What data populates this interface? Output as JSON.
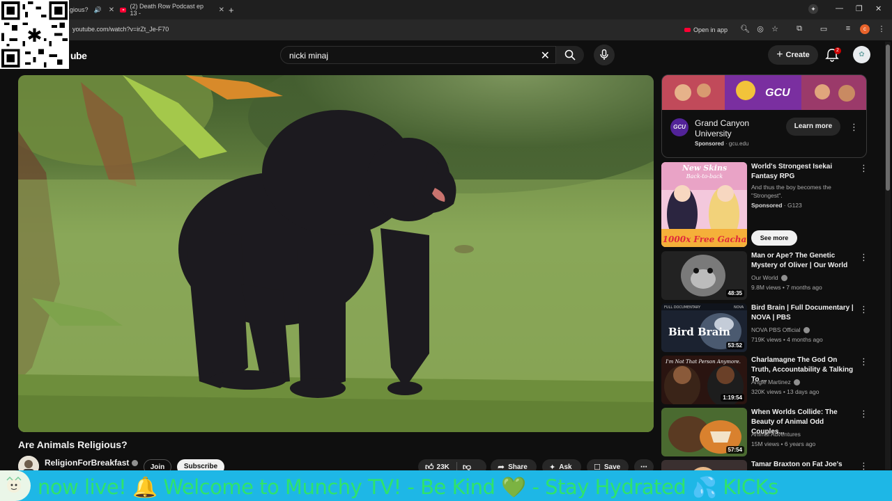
{
  "browser": {
    "tabs": [
      {
        "label": "gious?",
        "active": true
      },
      {
        "label": "(2) Death Row Podcast ep 13 -",
        "active": false
      }
    ],
    "url": "youtube.com/watch?v=irZt_Je-F70",
    "open_in_app_label": "Open in app",
    "profile_initial": "c"
  },
  "header": {
    "logo_fragment": "ube",
    "search_query": "nicki minaj",
    "create_label": "Create",
    "notification_count": "2"
  },
  "video": {
    "title": "Are Animals Religious?",
    "channel": "ReligionForBreakfast",
    "join_label": "Join",
    "subscribe_label": "Subscribe",
    "likes": "23K",
    "share_label": "Share",
    "ask_label": "Ask",
    "save_label": "Save"
  },
  "ad": {
    "banner_text": "GCU",
    "logo_text": "GCU",
    "title": "Grand Canyon University",
    "sponsored": "Sponsored",
    "domain": "· gcu.edu",
    "cta": "Learn more"
  },
  "recommendations": [
    {
      "title": "World's Strongest Isekai Fantasy RPG",
      "line1": "And thus the boy becomes the \"Strongest\".",
      "line2_bold": "Sponsored",
      "line2": "· G123",
      "duration": "",
      "cta": "See more",
      "thumb_text_top": "New Skins",
      "thumb_text_mid": "Back-to-back",
      "thumb_text_bottom": "1000x Free Gacha"
    },
    {
      "title": "Man or Ape? The Genetic Mystery of Oliver | Our World",
      "line1": "Our World",
      "line2": "9.8M views • 7 months ago",
      "duration": "48:35"
    },
    {
      "title": "Bird Brain | Full Documentary | NOVA | PBS",
      "line1": "NOVA PBS Official",
      "line2": "719K views • 4 months ago",
      "duration": "53:52",
      "thumb_text": "Bird Brain",
      "thumb_tag_left": "FULL DOCUMENTARY",
      "thumb_tag_right": "NOVA"
    },
    {
      "title": "Charlamagne The God On Truth, Accountability & Talking To ...",
      "line1": "Angie Martinez",
      "line2": "320K views • 13 days ago",
      "duration": "1:19:54",
      "thumb_text": "I'm Not That Person Anymore."
    },
    {
      "title": "When Worlds Collide: The Beauty of Animal Odd Couples...",
      "line1": "Animal Adventures",
      "line2": "15M views • 6 years ago",
      "duration": "57:54"
    },
    {
      "title": "Tamar Braxton on Fat Joe's",
      "line1": "",
      "line2": "",
      "duration": ""
    }
  ],
  "ticker": {
    "text": "now live!  🔔     Welcome to Munchy TV!  - Be Kind 💚  - Stay Hydrated 💦  KICKs"
  }
}
